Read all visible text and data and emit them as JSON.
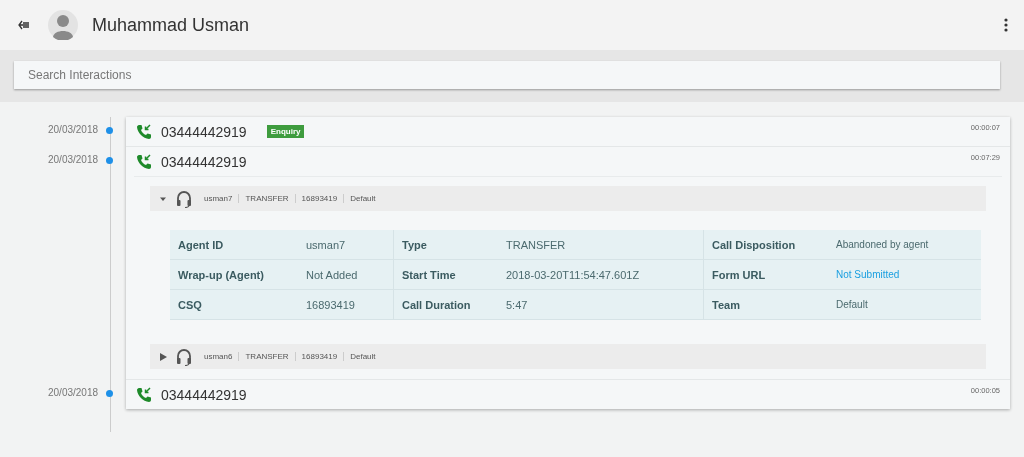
{
  "header": {
    "name": "Muhammad Usman"
  },
  "search": {
    "placeholder": "Search Interactions"
  },
  "interactions": [
    {
      "date": "20/03/2018",
      "number": "03444442919",
      "tag": "Enquiry",
      "duration": "00:00:07"
    },
    {
      "date": "20/03/2018",
      "number": "03444442919",
      "duration": "00:07:29",
      "legs": [
        {
          "expanded": true,
          "agent": "usman7",
          "type": "TRANSFER",
          "csq": "16893419",
          "team": "Default",
          "details": [
            [
              {
                "label": "Agent ID",
                "value": "usman7",
                "kind": "text"
              },
              {
                "label": "Type",
                "value": "TRANSFER",
                "kind": "text"
              },
              {
                "label": "Call Disposition",
                "value": "Abandoned by agent",
                "kind": "small"
              }
            ],
            [
              {
                "label": "Wrap-up (Agent)",
                "value": "Not Added",
                "kind": "text"
              },
              {
                "label": "Start Time",
                "value": "2018-03-20T11:54:47.601Z",
                "kind": "text"
              },
              {
                "label": "Form URL",
                "value": "Not Submitted",
                "kind": "link"
              }
            ],
            [
              {
                "label": "CSQ",
                "value": "16893419",
                "kind": "text"
              },
              {
                "label": "Call Duration",
                "value": "5:47",
                "kind": "text"
              },
              {
                "label": "Team",
                "value": "Default",
                "kind": "small"
              }
            ]
          ]
        },
        {
          "expanded": false,
          "agent": "usman6",
          "type": "TRANSFER",
          "csq": "16893419",
          "team": "Default"
        }
      ]
    },
    {
      "date": "20/03/2018",
      "number": "03444442919",
      "duration": "00:00:05"
    }
  ]
}
